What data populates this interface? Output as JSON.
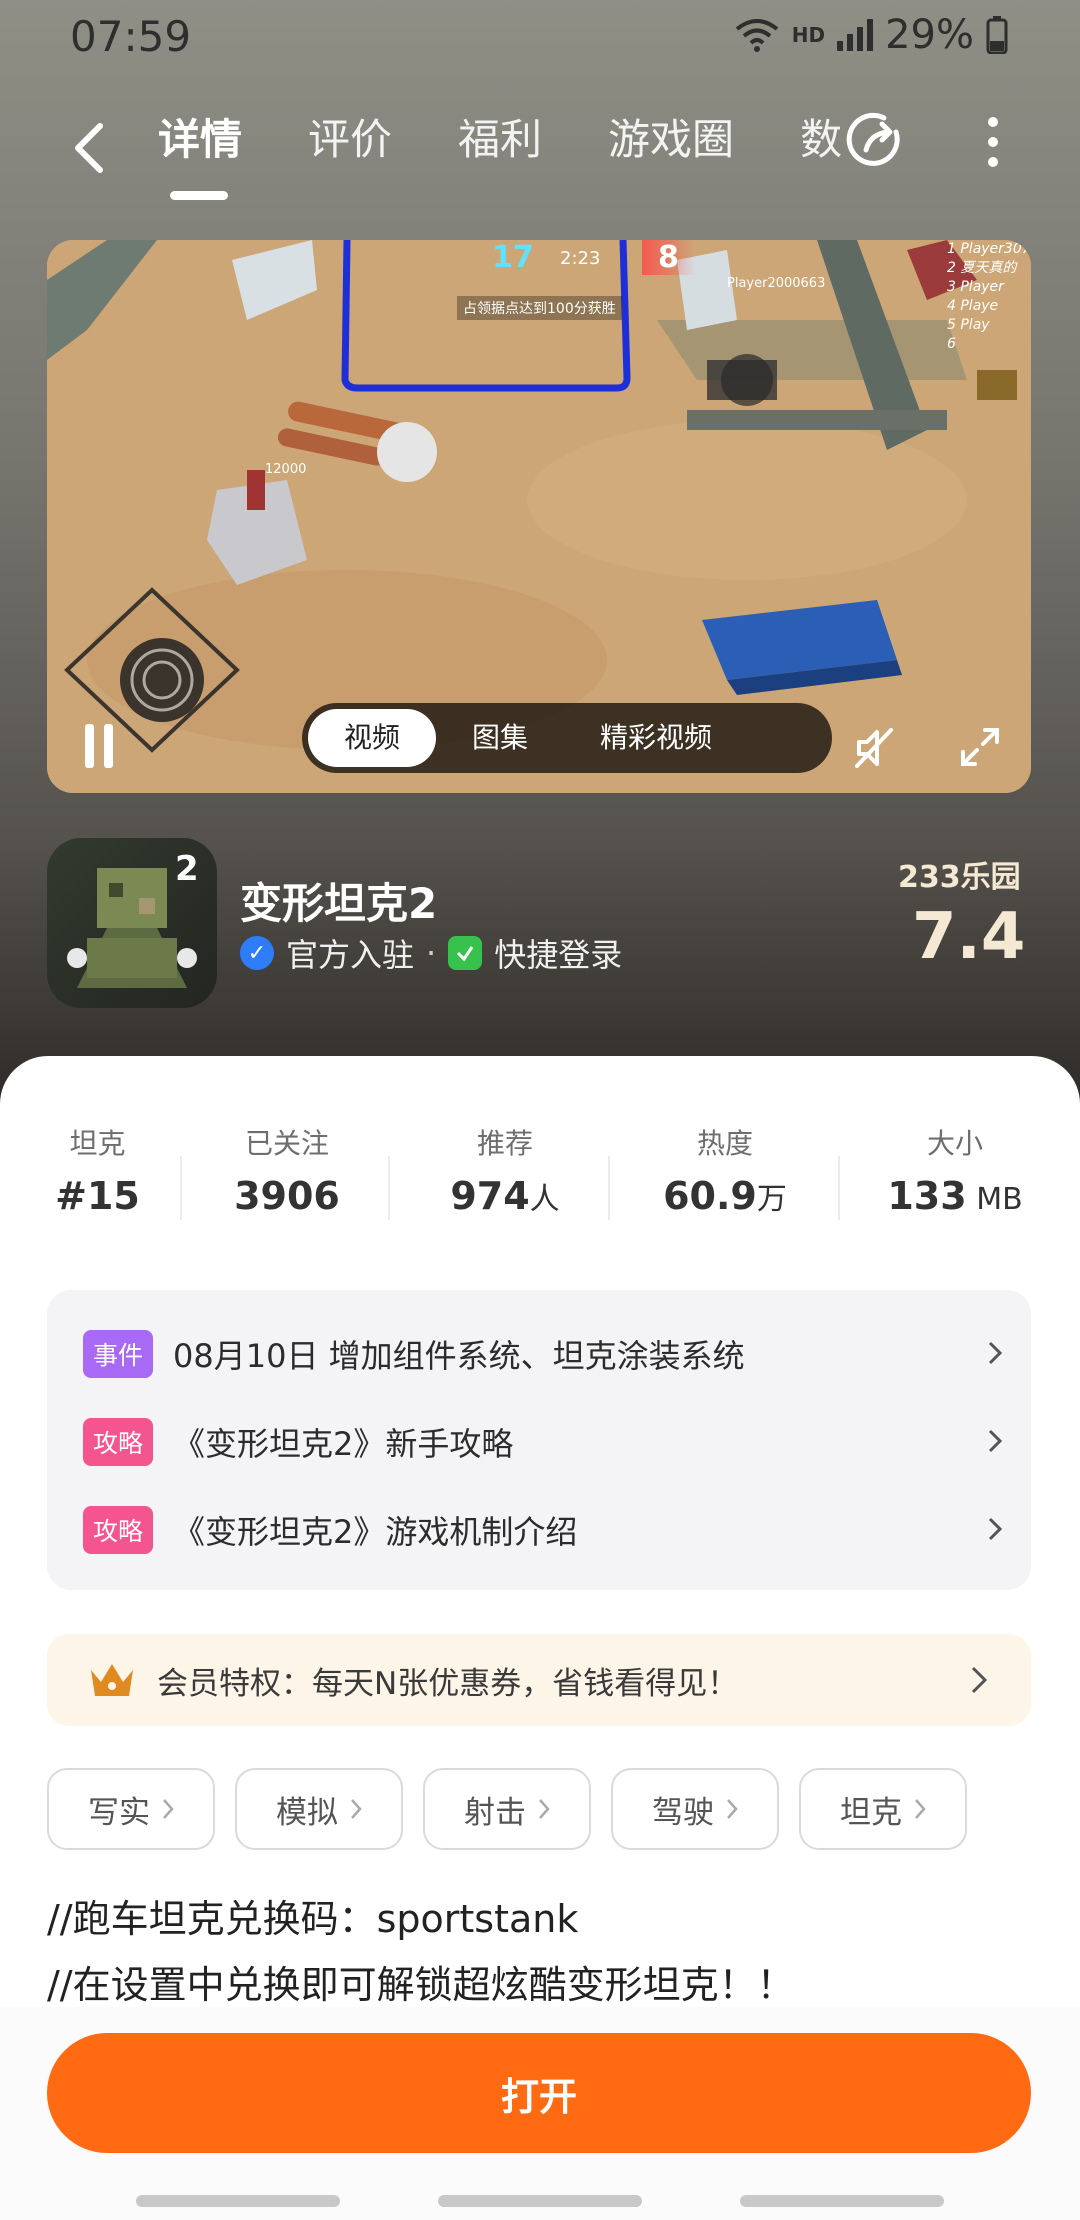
{
  "status_bar": {
    "time": "07:59",
    "network": "HD",
    "battery": "29%"
  },
  "nav": {
    "tabs": [
      {
        "label": "详情",
        "active": true
      },
      {
        "label": "评价",
        "active": false
      },
      {
        "label": "福利",
        "active": false
      },
      {
        "label": "游戏圈",
        "active": false
      },
      {
        "label": "数",
        "active": false
      }
    ],
    "icons": [
      "back-arrow-icon",
      "share-icon",
      "more-vert-icon"
    ]
  },
  "media": {
    "tabs": [
      {
        "label": "视频",
        "active": true
      },
      {
        "label": "图集",
        "active": false
      },
      {
        "label": "精彩视频",
        "active": false
      }
    ],
    "hud": {
      "score_left": "17",
      "timer": "2:23",
      "score_right": "8",
      "objective": "占领据点达到100分获胜",
      "player": "Player2000663",
      "hp": "12000",
      "leaderboard": [
        "1 Player307",
        "2 夏天真的",
        "3 Player",
        "4 Playe",
        "5 Play",
        "6"
      ]
    }
  },
  "app": {
    "title": "变形坦克2",
    "official": "官方入驻",
    "quick_login": "快捷登录",
    "brand": "233乐园",
    "rating": "7.4"
  },
  "stats": [
    {
      "label": "坦克",
      "value": "#15",
      "unit": ""
    },
    {
      "label": "已关注",
      "value": "3906",
      "unit": ""
    },
    {
      "label": "推荐",
      "value": "974",
      "unit": "人"
    },
    {
      "label": "热度",
      "value": "60.9",
      "unit": "万"
    },
    {
      "label": "大小",
      "value": "133",
      "unit": " MB"
    }
  ],
  "news": [
    {
      "tag": "事件",
      "tag_color": "#a86af4",
      "text": "08月10日  增加组件系统、坦克涂装系统"
    },
    {
      "tag": "攻略",
      "tag_color": "#f4558e",
      "text": "《变形坦克2》新手攻略"
    },
    {
      "tag": "攻略",
      "tag_color": "#f4558e",
      "text": "《变形坦克2》游戏机制介绍"
    }
  ],
  "vip": {
    "text": "会员特权：每天N张优惠券，省钱看得见！"
  },
  "chips": [
    "写实",
    "模拟",
    "射击",
    "驾驶",
    "坦克"
  ],
  "description": [
    "//跑车坦克兑换码：sportstank",
    "//在设置中兑换即可解锁超炫酷变形坦克！！"
  ],
  "open_button": "打开",
  "colors": {
    "accent": "#ff6a13",
    "event_tag": "#a86af4",
    "guide_tag": "#f4558e"
  }
}
